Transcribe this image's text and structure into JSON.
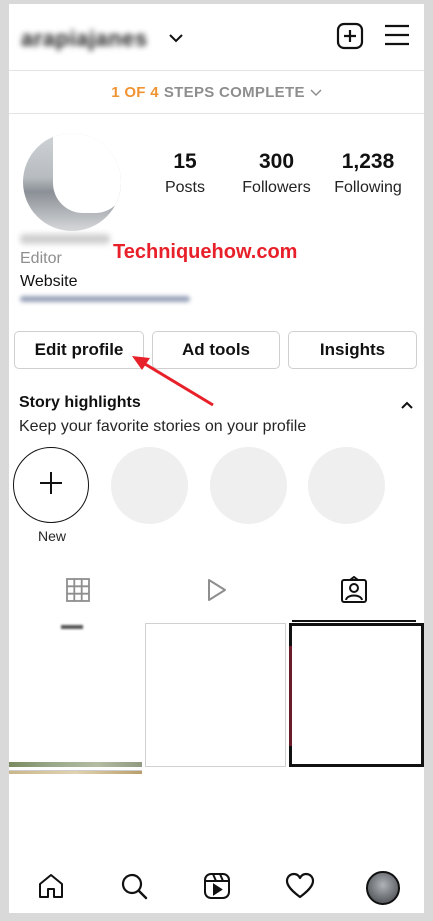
{
  "header": {
    "username": "arapiajanes",
    "icons": [
      "chevron-down-icon",
      "add-post-icon",
      "menu-icon"
    ]
  },
  "onboarding": {
    "steps_count": "1 OF 4",
    "steps_text": "STEPS COMPLETE",
    "accent": "#f09433"
  },
  "profile": {
    "stats": [
      {
        "value": "15",
        "label": "Posts"
      },
      {
        "value": "300",
        "label": "Followers"
      },
      {
        "value": "1,238",
        "label": "Following"
      }
    ],
    "role": "Editor",
    "website_label": "Website"
  },
  "watermark": {
    "text": "Techniquehow.com",
    "color": "#e8202a"
  },
  "actions": {
    "edit_profile": "Edit profile",
    "ad_tools": "Ad tools",
    "insights": "Insights"
  },
  "highlights": {
    "title": "Story highlights",
    "subtitle": "Keep your favorite stories on your profile",
    "new_label": "New"
  },
  "tabs": [
    {
      "name": "grid",
      "icon": "grid-icon",
      "active": false
    },
    {
      "name": "reels",
      "icon": "play-icon",
      "active": false
    },
    {
      "name": "tagged",
      "icon": "tagged-icon",
      "active": true
    }
  ],
  "bottom_nav": [
    "home-icon",
    "search-icon",
    "reels-icon",
    "heart-icon",
    "profile-avatar"
  ]
}
